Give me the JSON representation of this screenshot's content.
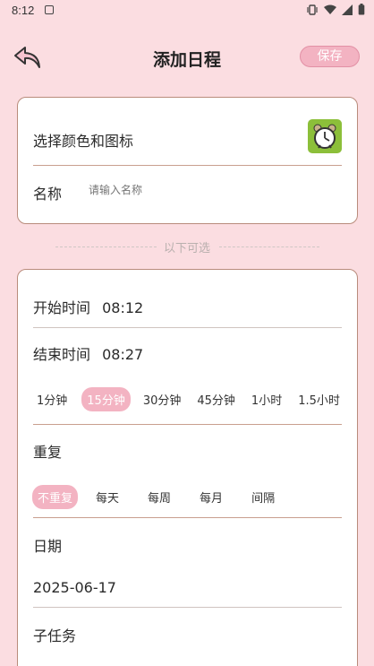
{
  "status_bar": {
    "time": "8:12"
  },
  "header": {
    "title": "添加日程",
    "save_label": "保存"
  },
  "card_basic": {
    "color_icon_label": "选择颜色和图标",
    "name_label": "名称",
    "name_placeholder": "请输入名称",
    "name_value": ""
  },
  "optional_label": "以下可选",
  "card_time": {
    "start_label": "开始时间",
    "start_value": "08:12",
    "end_label": "结束时间",
    "end_value": "08:27",
    "durations": [
      "1分钟",
      "15分钟",
      "30分钟",
      "45分钟",
      "1小时",
      "1.5小时"
    ],
    "selected_duration": "15分钟",
    "repeat_label": "重复",
    "repeat_options": [
      "不重复",
      "每天",
      "每周",
      "每月",
      "间隔"
    ],
    "selected_repeat": "不重复",
    "date_label": "日期",
    "date_value": "2025-06-17",
    "subtask_label": "子任务"
  },
  "colors": {
    "background": "#fbdde1",
    "accent": "#f3b3c2",
    "border": "#b98c7c",
    "icon_tile": "#8cbf3a"
  },
  "icons": {
    "back": "back-arrow-icon",
    "alarm": "alarm-clock-icon"
  }
}
